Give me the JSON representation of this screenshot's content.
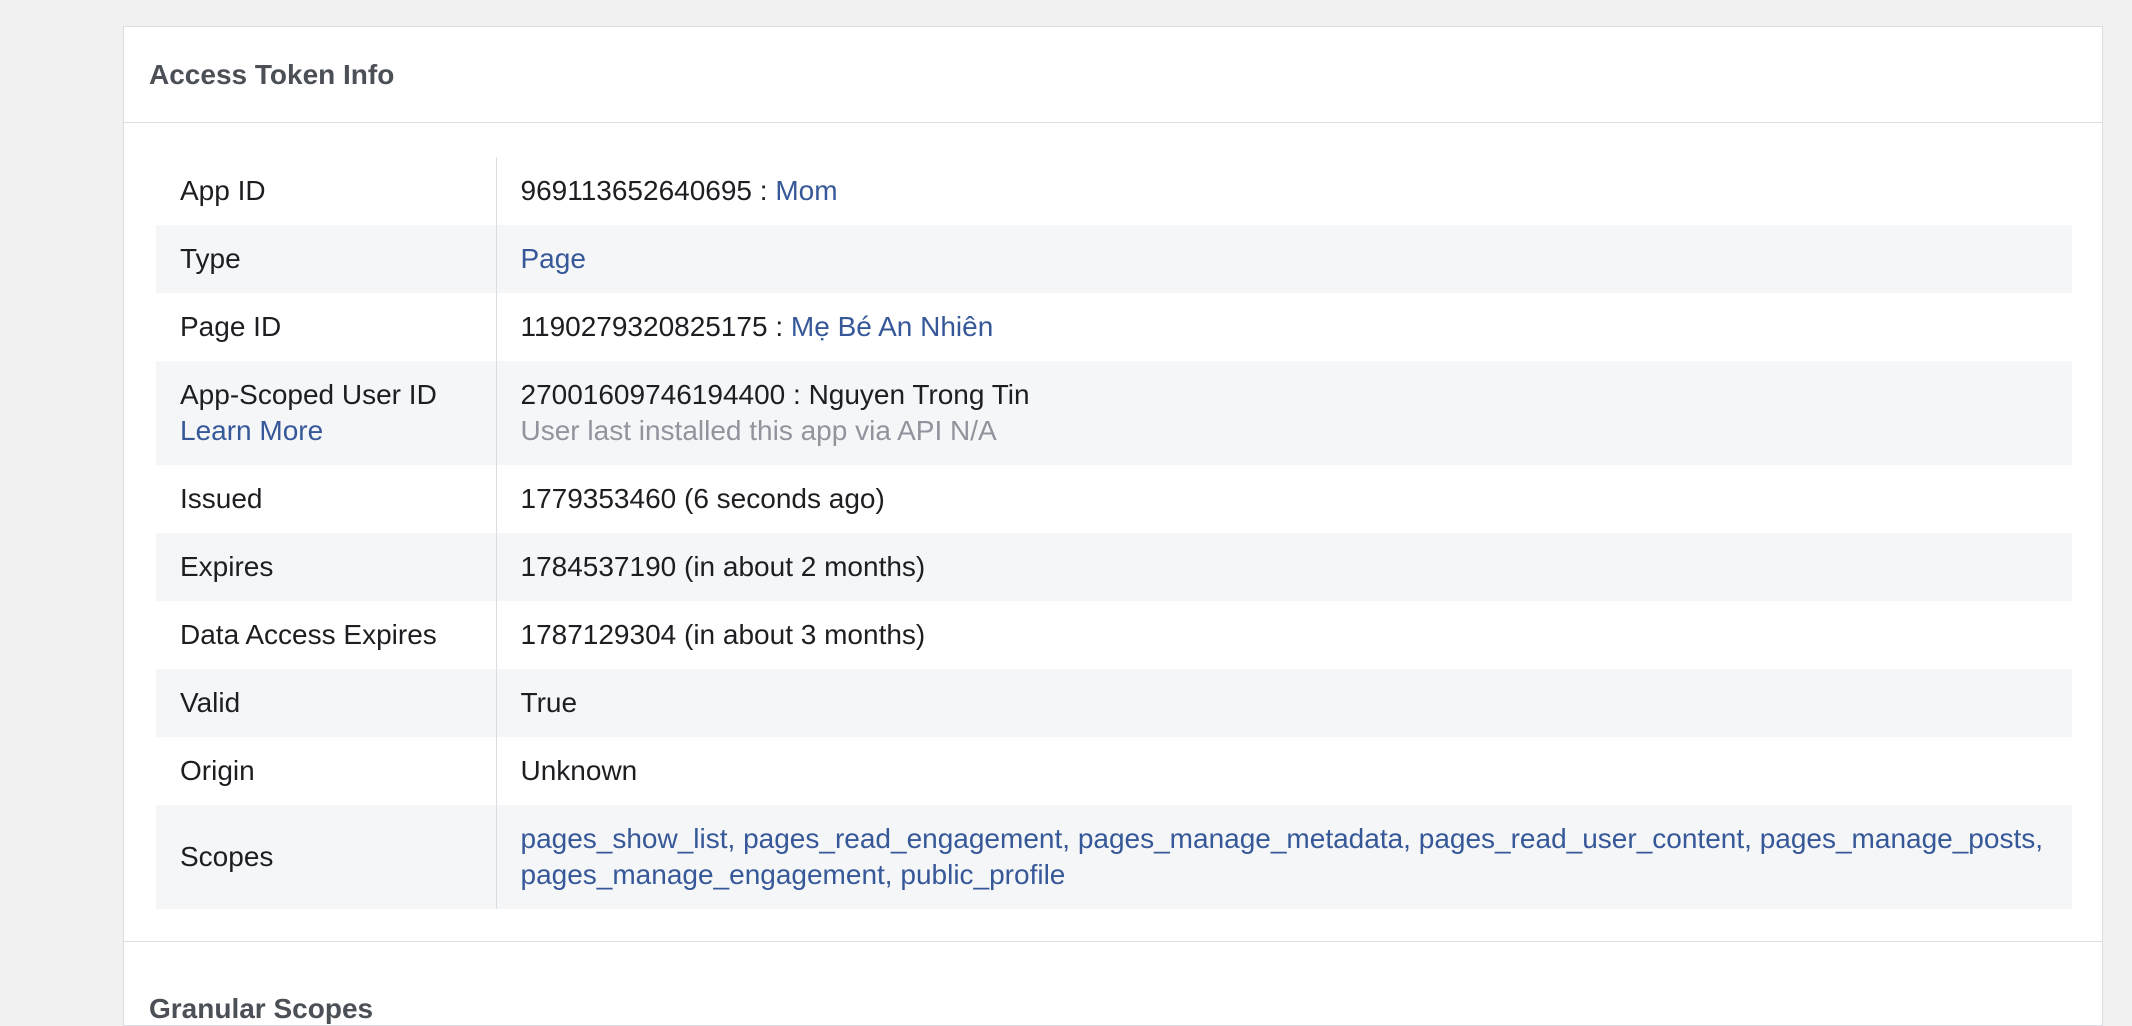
{
  "panel": {
    "title": "Access Token Info",
    "next_section_title": "Granular Scopes"
  },
  "rows": {
    "app_id": {
      "label": "App ID",
      "value": "969113652640695",
      "separator": " : ",
      "link": "Mom"
    },
    "type": {
      "label": "Type",
      "link": "Page"
    },
    "page_id": {
      "label": "Page ID",
      "value": "1190279320825175",
      "separator": " : ",
      "link": "Mẹ Bé An Nhiên"
    },
    "app_scoped_user_id": {
      "label": "App-Scoped User ID",
      "label_link": "Learn More",
      "value": "27001609746194400 : Nguyen Trong Tin",
      "note": "User last installed this app via API N/A"
    },
    "issued": {
      "label": "Issued",
      "value": "1779353460 (6 seconds ago)"
    },
    "expires": {
      "label": "Expires",
      "value": "1784537190 (in about 2 months)"
    },
    "data_access_expires": {
      "label": "Data Access Expires",
      "value": "1787129304 (in about 3 months)"
    },
    "valid": {
      "label": "Valid",
      "value": "True"
    },
    "origin": {
      "label": "Origin",
      "value": "Unknown"
    },
    "scopes": {
      "label": "Scopes",
      "items": [
        "pages_show_list,",
        "pages_read_engagement,",
        "pages_manage_metadata,",
        "pages_read_user_content,",
        "pages_manage_posts,",
        "pages_manage_engagement,",
        "public_profile"
      ]
    }
  },
  "colors": {
    "link": "#365899",
    "muted": "#90949c",
    "row_shade": "#f5f6f7",
    "border": "#dadde1",
    "page_background": "#f1f1f1"
  }
}
